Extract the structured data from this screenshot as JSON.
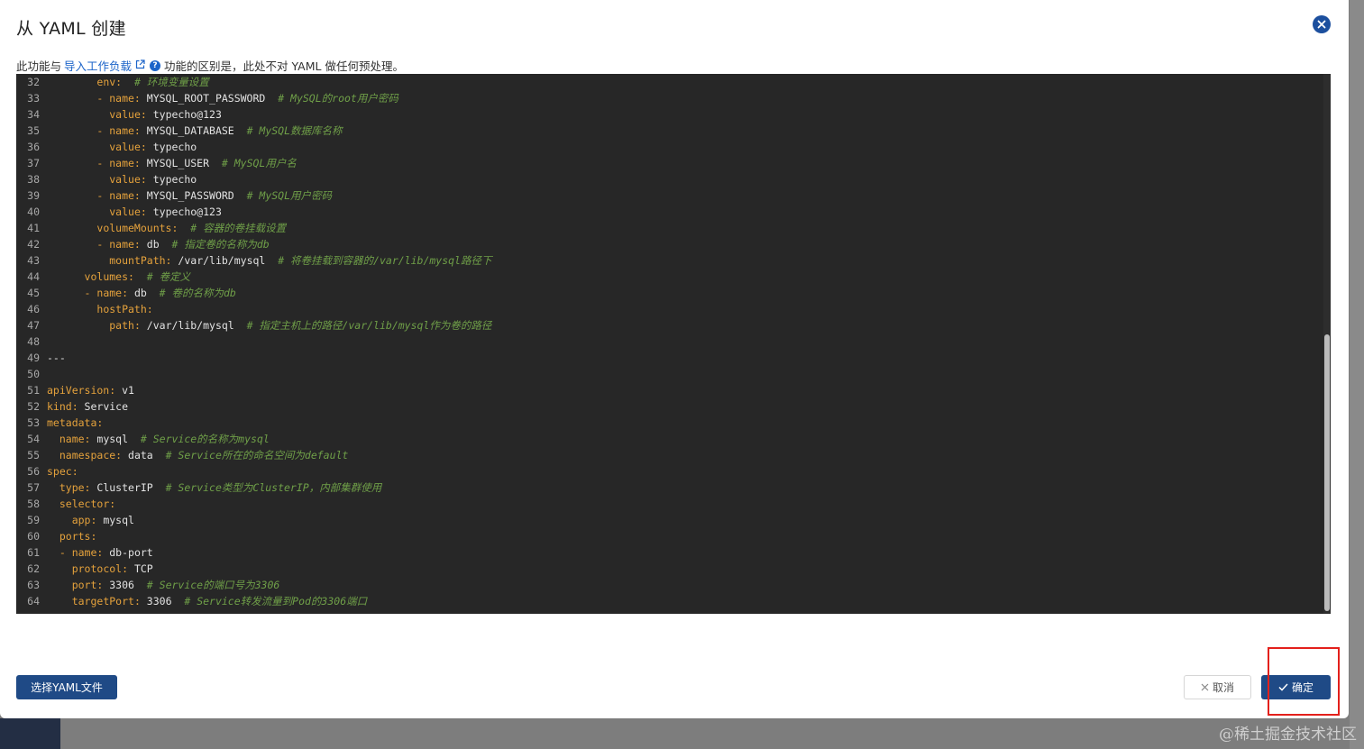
{
  "dialog": {
    "title": "从 YAML 创建",
    "notice_prefix": "此功能与",
    "notice_link": "导入工作负载",
    "notice_suffix": "功能的区别是，此处不对 YAML 做任何预处理。",
    "help_symbol": "?"
  },
  "editor": {
    "lines": [
      [
        {
          "t": "32",
          "c": "ln"
        },
        {
          "t": "        ",
          "c": "v"
        },
        {
          "t": "env:",
          "c": "k"
        },
        {
          "t": "  ",
          "c": "v"
        },
        {
          "t": "# 环境变量设置",
          "c": "c"
        }
      ],
      [
        {
          "t": "33",
          "c": "ln"
        },
        {
          "t": "        ",
          "c": "v"
        },
        {
          "t": "- name:",
          "c": "k"
        },
        {
          "t": " MYSQL_ROOT_PASSWORD  ",
          "c": "v"
        },
        {
          "t": "# MySQL的root用户密码",
          "c": "c"
        }
      ],
      [
        {
          "t": "34",
          "c": "ln"
        },
        {
          "t": "          ",
          "c": "v"
        },
        {
          "t": "value:",
          "c": "k"
        },
        {
          "t": " typecho@123",
          "c": "v"
        }
      ],
      [
        {
          "t": "35",
          "c": "ln"
        },
        {
          "t": "        ",
          "c": "v"
        },
        {
          "t": "- name:",
          "c": "k"
        },
        {
          "t": " MYSQL_DATABASE  ",
          "c": "v"
        },
        {
          "t": "# MySQL数据库名称",
          "c": "c"
        }
      ],
      [
        {
          "t": "36",
          "c": "ln"
        },
        {
          "t": "          ",
          "c": "v"
        },
        {
          "t": "value:",
          "c": "k"
        },
        {
          "t": " typecho",
          "c": "v"
        }
      ],
      [
        {
          "t": "37",
          "c": "ln"
        },
        {
          "t": "        ",
          "c": "v"
        },
        {
          "t": "- name:",
          "c": "k"
        },
        {
          "t": " MYSQL_USER  ",
          "c": "v"
        },
        {
          "t": "# MySQL用户名",
          "c": "c"
        }
      ],
      [
        {
          "t": "38",
          "c": "ln"
        },
        {
          "t": "          ",
          "c": "v"
        },
        {
          "t": "value:",
          "c": "k"
        },
        {
          "t": " typecho",
          "c": "v"
        }
      ],
      [
        {
          "t": "39",
          "c": "ln"
        },
        {
          "t": "        ",
          "c": "v"
        },
        {
          "t": "- name:",
          "c": "k"
        },
        {
          "t": " MYSQL_PASSWORD  ",
          "c": "v"
        },
        {
          "t": "# MySQL用户密码",
          "c": "c"
        }
      ],
      [
        {
          "t": "40",
          "c": "ln"
        },
        {
          "t": "          ",
          "c": "v"
        },
        {
          "t": "value:",
          "c": "k"
        },
        {
          "t": " typecho@123",
          "c": "v"
        }
      ],
      [
        {
          "t": "41",
          "c": "ln"
        },
        {
          "t": "        ",
          "c": "v"
        },
        {
          "t": "volumeMounts:",
          "c": "k"
        },
        {
          "t": "  ",
          "c": "v"
        },
        {
          "t": "# 容器的卷挂载设置",
          "c": "c"
        }
      ],
      [
        {
          "t": "42",
          "c": "ln"
        },
        {
          "t": "        ",
          "c": "v"
        },
        {
          "t": "- name:",
          "c": "k"
        },
        {
          "t": " db  ",
          "c": "v"
        },
        {
          "t": "# 指定卷的名称为db",
          "c": "c"
        }
      ],
      [
        {
          "t": "43",
          "c": "ln"
        },
        {
          "t": "          ",
          "c": "v"
        },
        {
          "t": "mountPath:",
          "c": "k"
        },
        {
          "t": " /var/lib/mysql  ",
          "c": "v"
        },
        {
          "t": "# 将卷挂载到容器的/var/lib/mysql路径下",
          "c": "c"
        }
      ],
      [
        {
          "t": "44",
          "c": "ln"
        },
        {
          "t": "      ",
          "c": "v"
        },
        {
          "t": "volumes:",
          "c": "k"
        },
        {
          "t": "  ",
          "c": "v"
        },
        {
          "t": "# 卷定义",
          "c": "c"
        }
      ],
      [
        {
          "t": "45",
          "c": "ln"
        },
        {
          "t": "      ",
          "c": "v"
        },
        {
          "t": "- name:",
          "c": "k"
        },
        {
          "t": " db  ",
          "c": "v"
        },
        {
          "t": "# 卷的名称为db",
          "c": "c"
        }
      ],
      [
        {
          "t": "46",
          "c": "ln"
        },
        {
          "t": "        ",
          "c": "v"
        },
        {
          "t": "hostPath:",
          "c": "k"
        }
      ],
      [
        {
          "t": "47",
          "c": "ln"
        },
        {
          "t": "          ",
          "c": "v"
        },
        {
          "t": "path:",
          "c": "k"
        },
        {
          "t": " /var/lib/mysql  ",
          "c": "v"
        },
        {
          "t": "# 指定主机上的路径/var/lib/mysql作为卷的路径",
          "c": "c"
        }
      ],
      [
        {
          "t": "48",
          "c": "ln"
        }
      ],
      [
        {
          "t": "49",
          "c": "ln"
        },
        {
          "t": "---",
          "c": "v"
        }
      ],
      [
        {
          "t": "50",
          "c": "ln"
        }
      ],
      [
        {
          "t": "51",
          "c": "ln"
        },
        {
          "t": "apiVersion:",
          "c": "k"
        },
        {
          "t": " v1",
          "c": "v"
        }
      ],
      [
        {
          "t": "52",
          "c": "ln"
        },
        {
          "t": "kind:",
          "c": "k"
        },
        {
          "t": " Service",
          "c": "v"
        }
      ],
      [
        {
          "t": "53",
          "c": "ln"
        },
        {
          "t": "metadata:",
          "c": "k"
        }
      ],
      [
        {
          "t": "54",
          "c": "ln"
        },
        {
          "t": "  ",
          "c": "v"
        },
        {
          "t": "name:",
          "c": "k"
        },
        {
          "t": " mysql  ",
          "c": "v"
        },
        {
          "t": "# Service的名称为mysql",
          "c": "c"
        }
      ],
      [
        {
          "t": "55",
          "c": "ln"
        },
        {
          "t": "  ",
          "c": "v"
        },
        {
          "t": "namespace:",
          "c": "k"
        },
        {
          "t": " data  ",
          "c": "v"
        },
        {
          "t": "# Service所在的命名空间为default",
          "c": "c"
        }
      ],
      [
        {
          "t": "56",
          "c": "ln"
        },
        {
          "t": "spec:",
          "c": "k"
        }
      ],
      [
        {
          "t": "57",
          "c": "ln"
        },
        {
          "t": "  ",
          "c": "v"
        },
        {
          "t": "type:",
          "c": "k"
        },
        {
          "t": " ClusterIP  ",
          "c": "v"
        },
        {
          "t": "# Service类型为ClusterIP，内部集群使用",
          "c": "c"
        }
      ],
      [
        {
          "t": "58",
          "c": "ln"
        },
        {
          "t": "  ",
          "c": "v"
        },
        {
          "t": "selector:",
          "c": "k"
        }
      ],
      [
        {
          "t": "59",
          "c": "ln"
        },
        {
          "t": "    ",
          "c": "v"
        },
        {
          "t": "app:",
          "c": "k"
        },
        {
          "t": " mysql",
          "c": "v"
        }
      ],
      [
        {
          "t": "60",
          "c": "ln"
        },
        {
          "t": "  ",
          "c": "v"
        },
        {
          "t": "ports:",
          "c": "k"
        }
      ],
      [
        {
          "t": "61",
          "c": "ln"
        },
        {
          "t": "  ",
          "c": "v"
        },
        {
          "t": "- name:",
          "c": "k"
        },
        {
          "t": " db-port",
          "c": "v"
        }
      ],
      [
        {
          "t": "62",
          "c": "ln"
        },
        {
          "t": "    ",
          "c": "v"
        },
        {
          "t": "protocol:",
          "c": "k"
        },
        {
          "t": " TCP",
          "c": "v"
        }
      ],
      [
        {
          "t": "63",
          "c": "ln"
        },
        {
          "t": "    ",
          "c": "v"
        },
        {
          "t": "port:",
          "c": "k"
        },
        {
          "t": " 3306  ",
          "c": "v"
        },
        {
          "t": "# Service的端口号为3306",
          "c": "c"
        }
      ],
      [
        {
          "t": "64",
          "c": "ln"
        },
        {
          "t": "    ",
          "c": "v"
        },
        {
          "t": "targetPort:",
          "c": "k"
        },
        {
          "t": " 3306  ",
          "c": "v"
        },
        {
          "t": "# Service转发流量到Pod的3306端口",
          "c": "c"
        }
      ]
    ]
  },
  "footer": {
    "select_file_label": "选择YAML文件",
    "cancel_label": "取消",
    "confirm_label": "确定"
  },
  "watermark": "@稀土掘金技术社区",
  "colors": {
    "primary": "#1f4a86",
    "link": "#1c64c9",
    "editor_bg": "#272727",
    "yaml_key": "#e5a23c",
    "yaml_comment": "#6f9f48",
    "highlight": "#e3201b"
  }
}
